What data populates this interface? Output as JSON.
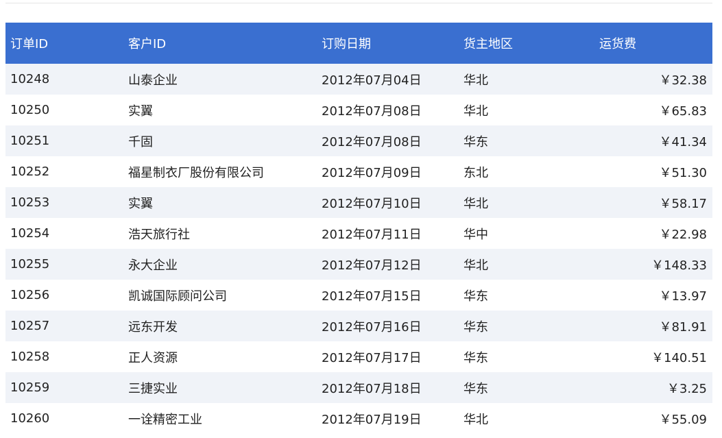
{
  "table": {
    "columns": [
      "订单ID",
      "客户ID",
      "订购日期",
      "货主地区",
      "运货费"
    ],
    "rows": [
      [
        "10248",
        "山泰企业",
        "2012年07月04日",
        "华北",
        "￥32.38"
      ],
      [
        "10250",
        "实翼",
        "2012年07月08日",
        "华北",
        "￥65.83"
      ],
      [
        "10251",
        "千固",
        "2012年07月08日",
        "华东",
        "￥41.34"
      ],
      [
        "10252",
        "福星制衣厂股份有限公司",
        "2012年07月09日",
        "东北",
        "￥51.30"
      ],
      [
        "10253",
        "实翼",
        "2012年07月10日",
        "华北",
        "￥58.17"
      ],
      [
        "10254",
        "浩天旅行社",
        "2012年07月11日",
        "华中",
        "￥22.98"
      ],
      [
        "10255",
        "永大企业",
        "2012年07月12日",
        "华北",
        "￥148.33"
      ],
      [
        "10256",
        "凯诚国际顾问公司",
        "2012年07月15日",
        "华东",
        "￥13.97"
      ],
      [
        "10257",
        "远东开发",
        "2012年07月16日",
        "华东",
        "￥81.91"
      ],
      [
        "10258",
        "正人资源",
        "2012年07月17日",
        "华东",
        "￥140.51"
      ],
      [
        "10259",
        "三捷实业",
        "2012年07月18日",
        "华东",
        "￥3.25"
      ],
      [
        "10260",
        "一诠精密工业",
        "2012年07月19日",
        "华北",
        "￥55.09"
      ]
    ]
  },
  "colors": {
    "header_bg": "#3a6fd0",
    "header_text": "#ffffff",
    "stripe_bg": "#f0f3f8"
  }
}
